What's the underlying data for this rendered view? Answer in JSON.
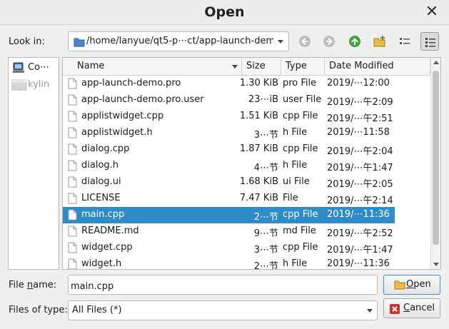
{
  "window": {
    "title": "Open",
    "close_symbol": "✕"
  },
  "lookin": {
    "label": "Look in:",
    "path": "/home/lanyue/qt5-p⋯ct/app-launch-demo"
  },
  "toolbar": {
    "back_icon": "back-arrow-icon",
    "forward_icon": "forward-arrow-icon",
    "parent_icon": "parent-directory-icon",
    "new_folder_icon": "new-folder-icon",
    "list_view_icon": "list-view-icon",
    "detail_view_icon": "detail-view-icon"
  },
  "sidebar": {
    "items": [
      {
        "label": "Co⋯",
        "icon": "computer-icon"
      },
      {
        "label": "kylin",
        "icon": "drive-icon"
      }
    ]
  },
  "columns": {
    "name": "Name",
    "size": "Size",
    "type": "Type",
    "date": "Date Modified"
  },
  "files": [
    {
      "name": "app-launch-demo.pro",
      "size": "1.30 KiB",
      "type": "pro File",
      "date": "2019/⋯12:00"
    },
    {
      "name": "app-launch-demo.pro.user",
      "size": "23⋯iB",
      "type": "user File",
      "date": "2019/⋯午2:09"
    },
    {
      "name": "applistwidget.cpp",
      "size": "1.51 KiB",
      "type": "cpp File",
      "date": "2019/⋯午2:51"
    },
    {
      "name": "applistwidget.h",
      "size": "3⋯节",
      "type": "h File",
      "date": "2019/⋯11:58"
    },
    {
      "name": "dialog.cpp",
      "size": "1.87 KiB",
      "type": "cpp File",
      "date": "2019/⋯午2:04"
    },
    {
      "name": "dialog.h",
      "size": "4⋯节",
      "type": "h File",
      "date": "2019/⋯午1:47"
    },
    {
      "name": "dialog.ui",
      "size": "1.68 KiB",
      "type": "ui File",
      "date": "2019/⋯午2:05"
    },
    {
      "name": "LICENSE",
      "size": "7.47 KiB",
      "type": "File",
      "date": "2019/⋯午2:14"
    },
    {
      "name": "main.cpp",
      "size": "2⋯节",
      "type": "cpp File",
      "date": "2019/⋯11:36"
    },
    {
      "name": "README.md",
      "size": "9⋯节",
      "type": "md File",
      "date": "2019/⋯午2:52"
    },
    {
      "name": "widget.cpp",
      "size": "3⋯节",
      "type": "cpp File",
      "date": "2019/⋯午1:47"
    },
    {
      "name": "widget.h",
      "size": "2⋯节",
      "type": "h File",
      "date": "2019/⋯11:36"
    }
  ],
  "selected_index": 8,
  "filename": {
    "label_pre": "File ",
    "label_accel": "n",
    "label_post": "ame:",
    "value": "main.cpp"
  },
  "filetype": {
    "label": "Files of type:",
    "value": "All Files (*)"
  },
  "buttons": {
    "open_accel": "O",
    "open_rest": "pen",
    "cancel_accel": "C",
    "cancel_rest": "ancel"
  },
  "colors": {
    "selection": "#308cc6",
    "accent_green": "#3aa336",
    "folder": "#4a86c8"
  }
}
